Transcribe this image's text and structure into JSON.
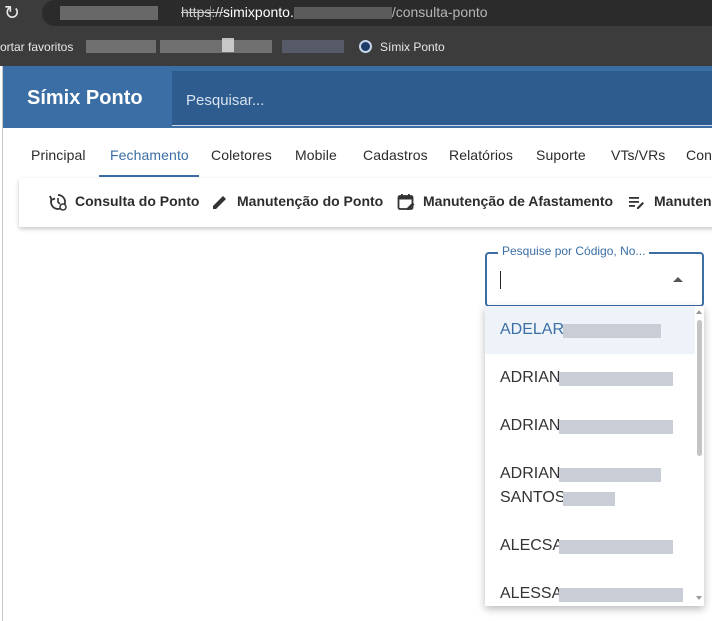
{
  "browser": {
    "url_scheme": "https://",
    "url_host": "simixponto.",
    "url_path": "/consulta-ponto",
    "bookmarks_cut_label": "ortar favoritos",
    "bookmark_label": "Símix Ponto"
  },
  "app": {
    "brand": "Símix Ponto",
    "search_placeholder": "Pesquisar...",
    "tabs": [
      {
        "label": "Principal"
      },
      {
        "label": "Fechamento"
      },
      {
        "label": "Coletores"
      },
      {
        "label": "Mobile"
      },
      {
        "label": "Cadastros"
      },
      {
        "label": "Relatórios"
      },
      {
        "label": "Suporte"
      },
      {
        "label": "VTs/VRs"
      },
      {
        "label": "Cons"
      }
    ],
    "active_tab": "Fechamento",
    "subnav": [
      {
        "label": "Consulta do Ponto",
        "icon": "history-settings-icon"
      },
      {
        "label": "Manutenção do Ponto",
        "icon": "pencil-icon"
      },
      {
        "label": "Manutenção de Afastamento",
        "icon": "calendar-edit-icon"
      },
      {
        "label": "Manuten",
        "icon": "list-edit-icon"
      }
    ],
    "employee_search": {
      "label": "Pesquise por Código, No...",
      "value": "",
      "options": [
        {
          "line1": "ADELAR"
        },
        {
          "line1": "ADRIAN"
        },
        {
          "line1": "ADRIAN"
        },
        {
          "line1": "ADRIAN",
          "line2": "SANTOS"
        },
        {
          "line1": "ALECSA"
        },
        {
          "line1": "ALESSA"
        }
      ]
    }
  },
  "colors": {
    "brand": "#3a6ea5",
    "search_bg": "#2e5c8e",
    "highlight_row": "#eef3f9"
  }
}
